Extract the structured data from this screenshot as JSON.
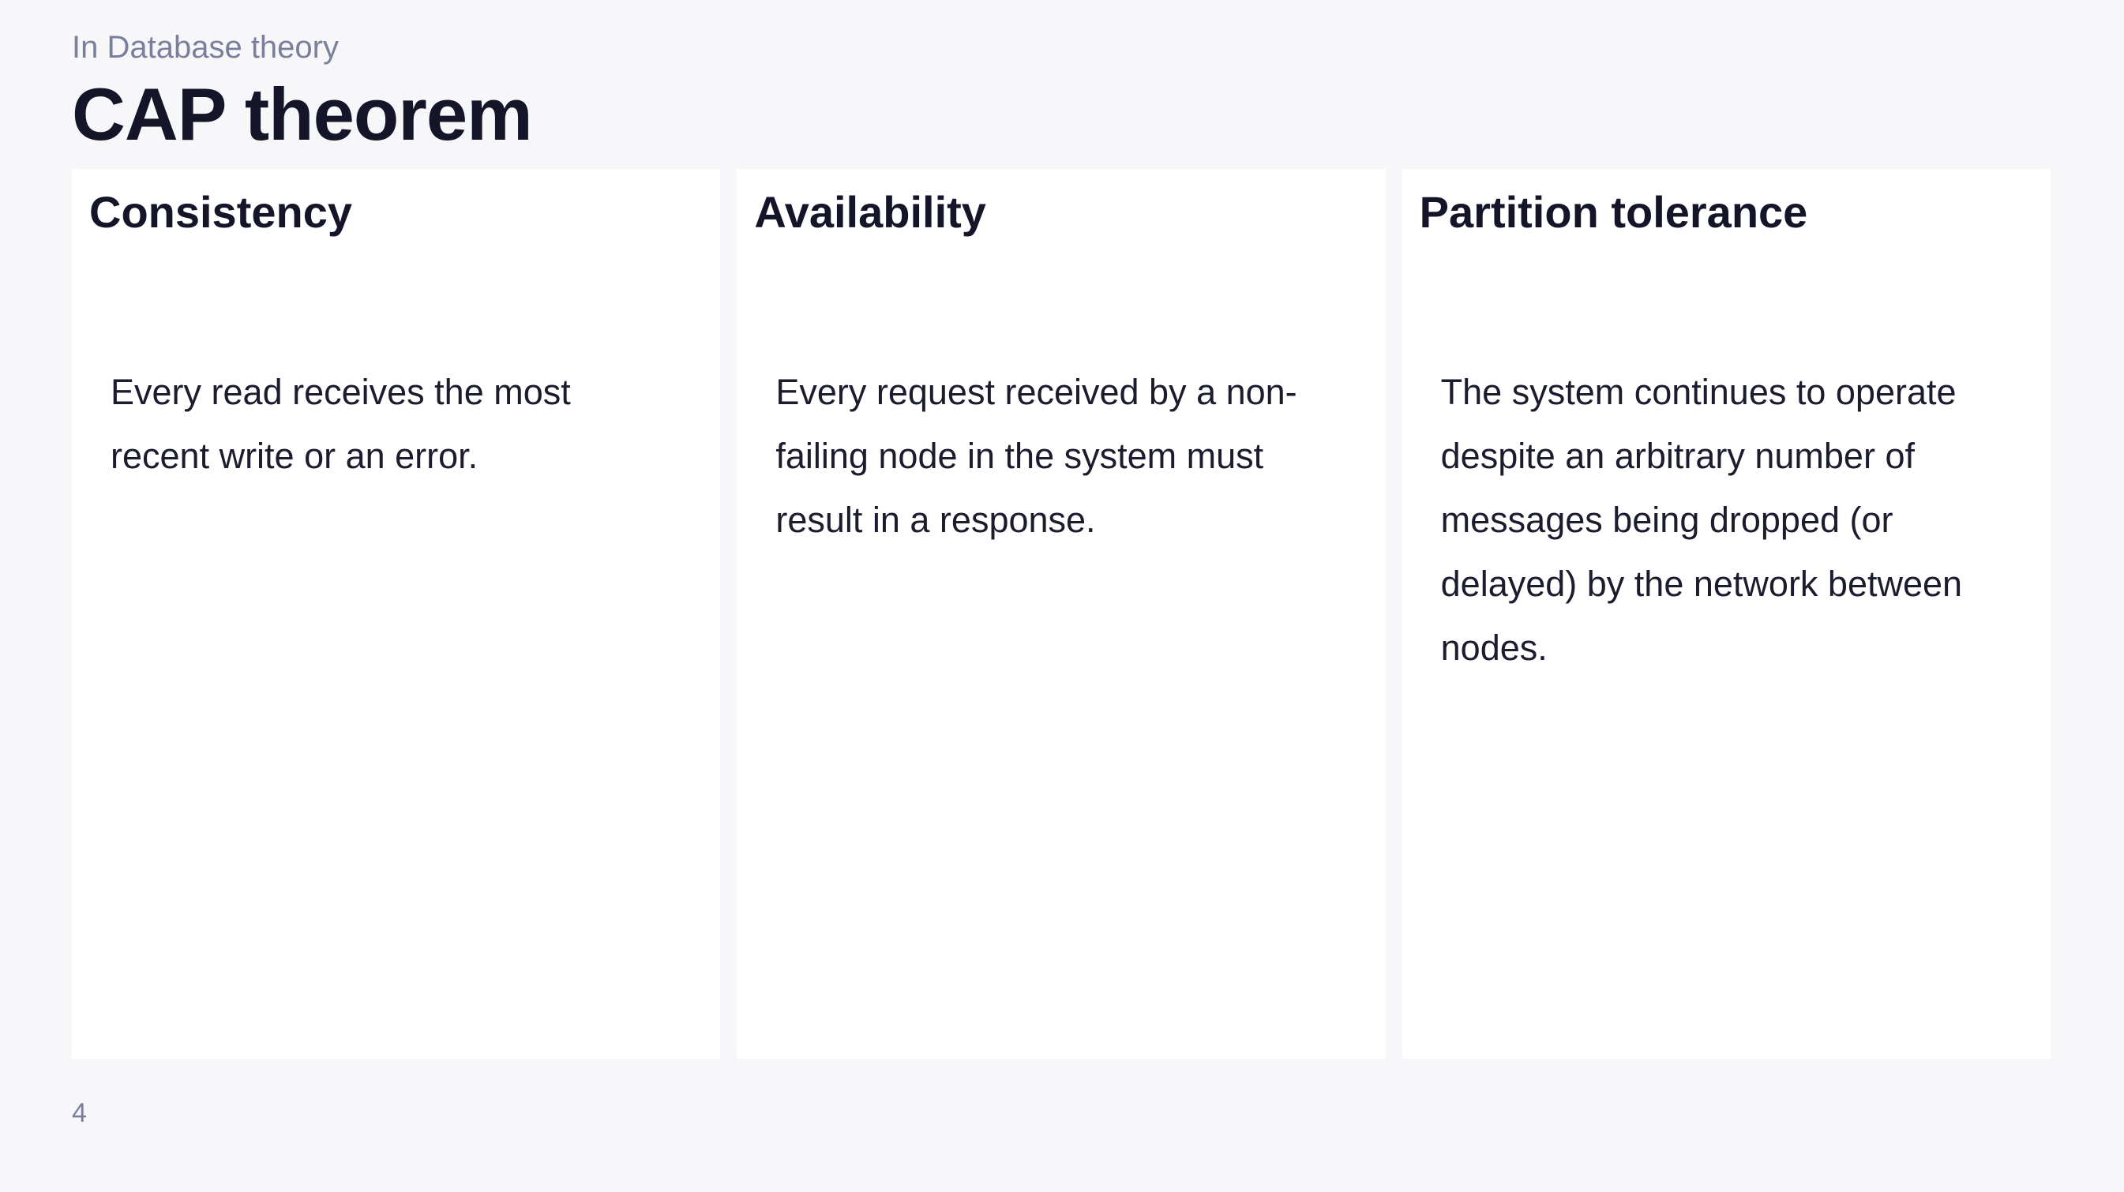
{
  "header": {
    "breadcrumb": "In Database theory",
    "title": "CAP theorem"
  },
  "cards": [
    {
      "heading": "Consistency",
      "body": "Every read receives the most recent write or an error."
    },
    {
      "heading": "Availability",
      "body": "Every request received by a non-failing node in the system must result in a response."
    },
    {
      "heading": "Partition tolerance",
      "body": "The system continues to operate despite an arbitrary number of messages being dropped (or delayed) by the network between nodes."
    }
  ],
  "footer": {
    "page_number": "4"
  }
}
